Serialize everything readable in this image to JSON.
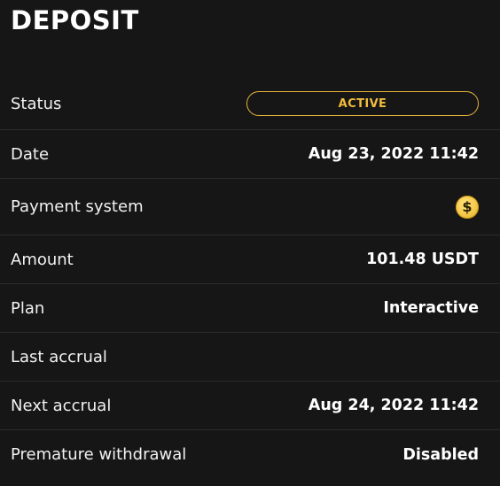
{
  "title": "DEPOSIT",
  "rows": {
    "status": {
      "label": "Status",
      "value": "ACTIVE",
      "color": "#e7b43c"
    },
    "date": {
      "label": "Date",
      "value": "Aug 23, 2022 11:42"
    },
    "payment_system": {
      "label": "Payment system",
      "icon": "dollar-coin-icon",
      "icon_glyph": "$",
      "color": "#f5c84a"
    },
    "amount": {
      "label": "Amount",
      "value": "101.48 USDT"
    },
    "plan": {
      "label": "Plan",
      "value": "Interactive"
    },
    "last_accrual": {
      "label": "Last accrual",
      "value": ""
    },
    "next_accrual": {
      "label": "Next accrual",
      "value": "Aug 24, 2022 11:42"
    },
    "premature_withdrawal": {
      "label": "Premature withdrawal",
      "value": "Disabled"
    }
  }
}
